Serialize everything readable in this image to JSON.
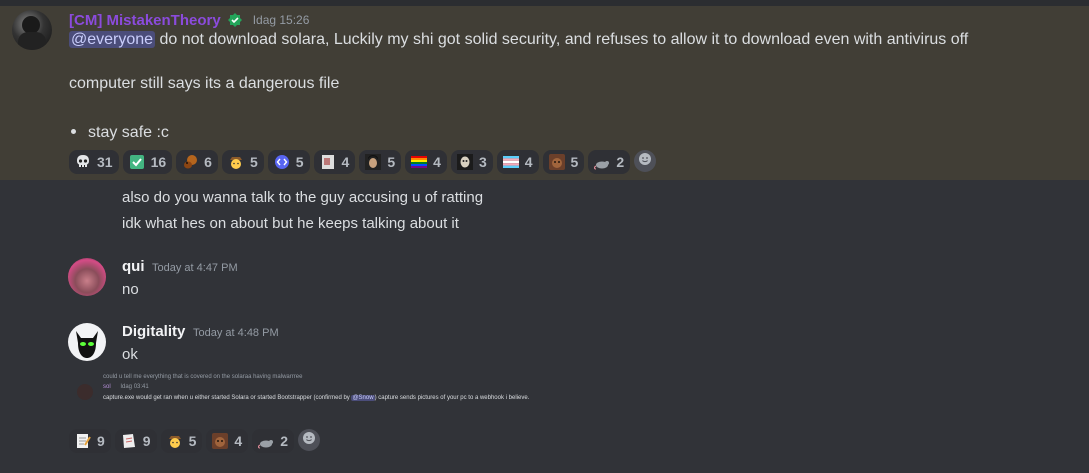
{
  "highlighted_message": {
    "author": "[CM] MistakenTheory",
    "timestamp": "Idag 15:26",
    "mention": "@everyone",
    "line1_text": " do not download solara, Luckily my shi got solid security, and refuses to allow it to download even with antivirus off",
    "line2_text": "computer still says its a dangerous file",
    "bullet_text": "stay safe :c",
    "reactions": [
      {
        "icon": "skull-icon",
        "count": "31"
      },
      {
        "icon": "check-icon",
        "count": "16"
      },
      {
        "icon": "squirrel-icon",
        "count": "6"
      },
      {
        "icon": "cowboy-face-icon",
        "count": "5"
      },
      {
        "icon": "code-icon",
        "count": "5"
      },
      {
        "icon": "paper-icon",
        "count": "4"
      },
      {
        "icon": "face-emoji-icon",
        "count": "5"
      },
      {
        "icon": "rainbow-flag-icon",
        "count": "4"
      },
      {
        "icon": "skull-face-icon",
        "count": "3"
      },
      {
        "icon": "trans-flag-icon",
        "count": "4"
      },
      {
        "icon": "dog-icon",
        "count": "5"
      },
      {
        "icon": "rat-icon",
        "count": "2"
      }
    ]
  },
  "continuation_lines": [
    "also do you wanna talk to the guy accusing u of ratting",
    "idk what hes on about but he keeps talking about it"
  ],
  "message_qui": {
    "author": "qui",
    "timestamp": "Today at 4:47 PM",
    "text": "no"
  },
  "message_digitality": {
    "author": "Digitality",
    "timestamp": "Today at 4:48 PM",
    "text": "ok"
  },
  "embedded_screenshot": {
    "reply_text": "could u tell me everything that is covered on the solaraa having malwarrree",
    "author": "sol",
    "timestamp": "Idag 03:41",
    "body_before": "capture.exe would get ran when u either started Solara or started Bootstrapper (confirmed by ",
    "mention": "@Snow",
    "body_after": ") capture sends pictures of your pc to a webhook i believe."
  },
  "bottom_reactions": [
    {
      "icon": "memo-icon",
      "count": "9"
    },
    {
      "icon": "page-icon",
      "count": "9"
    },
    {
      "icon": "cowboy-face-icon",
      "count": "5"
    },
    {
      "icon": "dog-icon",
      "count": "4"
    },
    {
      "icon": "rat-icon",
      "count": "2"
    }
  ],
  "colors": {
    "background": "#313338",
    "highlight": "#413e36",
    "author_purple": "#8b4bdc",
    "mention_bg": "#4b4d7a"
  }
}
